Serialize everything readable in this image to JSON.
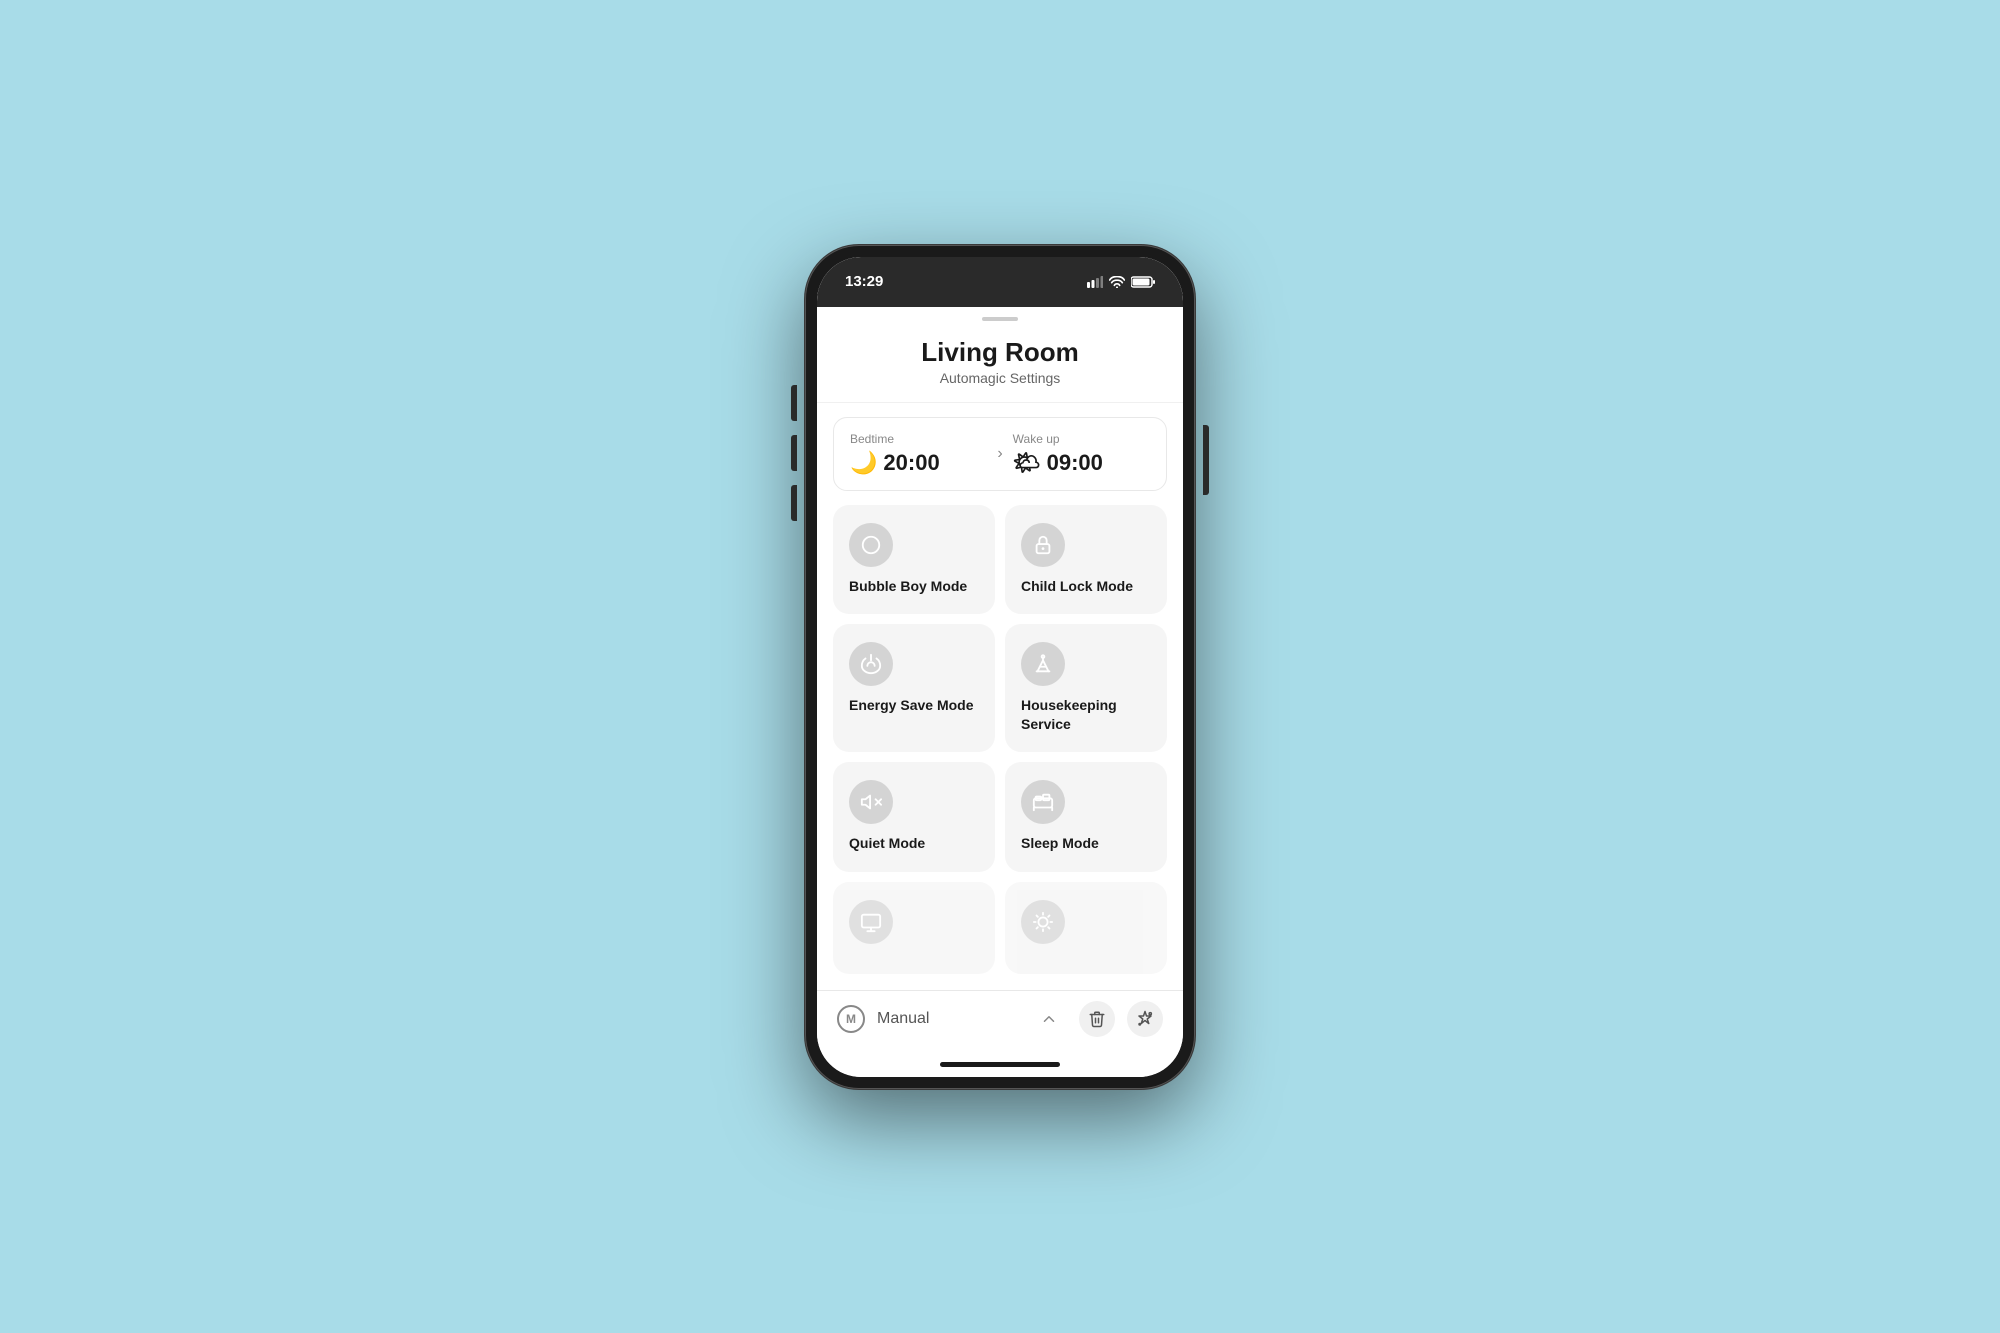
{
  "page": {
    "title": "Living Room",
    "subtitle": "Automagic Settings"
  },
  "status_bar": {
    "time": "13:29",
    "signal": "▪▪▪",
    "wifi": "wifi",
    "battery": "battery"
  },
  "schedule": {
    "bedtime_label": "Bedtime",
    "bedtime_time": "20:00",
    "bedtime_icon": "🌙",
    "wakeup_label": "Wake up",
    "wakeup_time": "09:00",
    "wakeup_icon": "🌤"
  },
  "modes": [
    {
      "id": "bubble-boy",
      "label": "Bubble Boy Mode",
      "icon": "circle"
    },
    {
      "id": "child-lock",
      "label": "Child Lock Mode",
      "icon": "lock"
    },
    {
      "id": "energy-save",
      "label": "Energy Save Mode",
      "icon": "plugin"
    },
    {
      "id": "housekeeping",
      "label": "Housekeeping Service",
      "icon": "broom"
    },
    {
      "id": "quiet-mode",
      "label": "Quiet Mode",
      "icon": "speaker"
    },
    {
      "id": "sleep-mode",
      "label": "Sleep Mode",
      "icon": "bed"
    },
    {
      "id": "tv-mode",
      "label": "",
      "icon": "tv"
    },
    {
      "id": "light-mode",
      "label": "",
      "icon": "light"
    }
  ],
  "bottom_bar": {
    "manual_letter": "M",
    "manual_label": "Manual",
    "chevron_up": "up",
    "trash_label": "delete",
    "magic_label": "magic"
  }
}
